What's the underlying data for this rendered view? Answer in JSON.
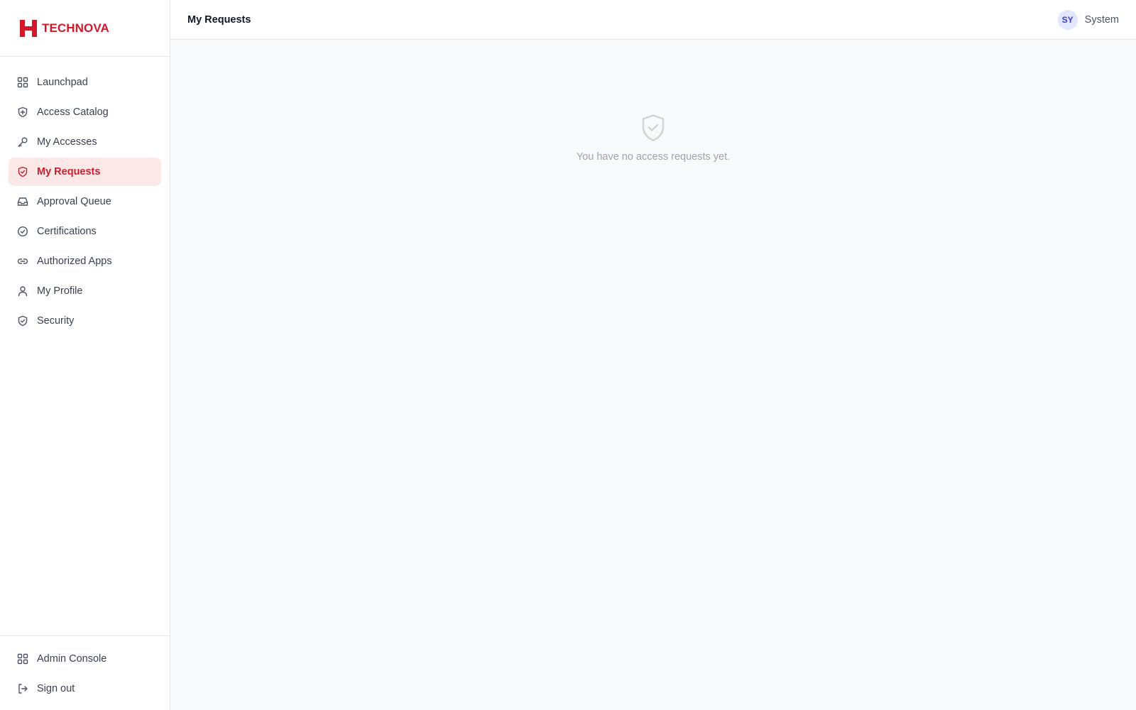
{
  "brand": {
    "name": "TECHNOVA",
    "logo_icon": "h-logo-icon",
    "color": "#d3182a"
  },
  "sidebar": {
    "items": [
      {
        "label": "Launchpad",
        "icon": "grid-icon",
        "active": false
      },
      {
        "label": "Access Catalog",
        "icon": "shield-plus-icon",
        "active": false
      },
      {
        "label": "My Accesses",
        "icon": "key-icon",
        "active": false
      },
      {
        "label": "My Requests",
        "icon": "shield-check-icon",
        "active": true
      },
      {
        "label": "Approval Queue",
        "icon": "inbox-icon",
        "active": false
      },
      {
        "label": "Certifications",
        "icon": "circle-check-icon",
        "active": false
      },
      {
        "label": "Authorized Apps",
        "icon": "link-icon",
        "active": false
      },
      {
        "label": "My Profile",
        "icon": "user-icon",
        "active": false
      },
      {
        "label": "Security",
        "icon": "shield-check-icon",
        "active": false
      }
    ],
    "bottom_items": [
      {
        "label": "Admin Console",
        "icon": "grid-icon"
      },
      {
        "label": "Sign out",
        "icon": "sign-out-icon"
      }
    ],
    "active_color": "#c81e2c",
    "active_bg": "#fde8e8"
  },
  "header": {
    "title": "My Requests",
    "user": {
      "initials": "SY",
      "name": "System"
    }
  },
  "main": {
    "empty_state": {
      "icon": "shield-check-icon",
      "message": "You have no access requests yet."
    }
  }
}
